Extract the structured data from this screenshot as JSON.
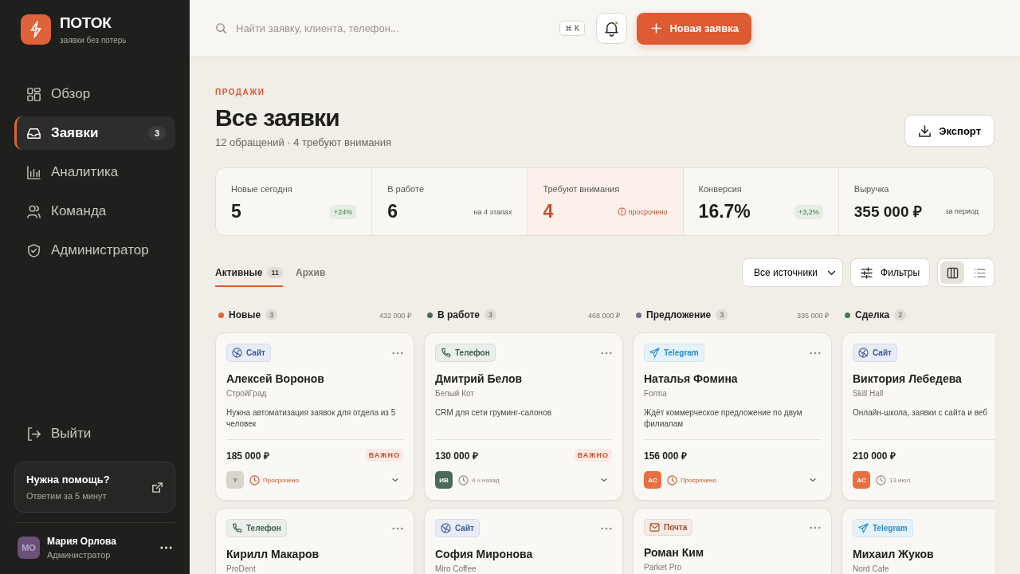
{
  "sidebar": {
    "brand": {
      "name": "ПОТОК",
      "tagline": "заявки без потерь"
    },
    "nav": [
      {
        "label": "Обзор",
        "kind": "grid",
        "selected": false
      },
      {
        "label": "Заявки",
        "kind": "inbox",
        "selected": true,
        "badge": "3"
      },
      {
        "label": "Аналитика",
        "kind": "chart",
        "selected": false
      },
      {
        "label": "Команда",
        "kind": "users",
        "selected": false
      },
      {
        "label": "Администратор",
        "kind": "shield",
        "selected": false
      }
    ],
    "logout": "Выйти",
    "help": {
      "title": "Нужна помощь?",
      "subtitle": "Ответим за 5 минут"
    },
    "user": {
      "initials": "МО",
      "name": "Мария Орлова",
      "role": "Администратор"
    }
  },
  "topbar": {
    "search": {
      "placeholder": "Найти заявку, клиента, телефон..."
    },
    "shortcut": [
      "⌘",
      "K"
    ],
    "notifications": {
      "unread": true
    },
    "new_button": "Новая заявка"
  },
  "header": {
    "eyebrow": "ПРОДАЖИ",
    "title": "Все заявки",
    "subtitle": "12 обращений · 4 требуют внимания",
    "export_button": "Экспорт"
  },
  "stats": [
    {
      "label": "Новые сегодня",
      "value": "5",
      "note": "+24%",
      "kind": "badge",
      "alert": false
    },
    {
      "label": "В работе",
      "value": "6",
      "note": "на 4 этапах",
      "kind": "text",
      "alert": false
    },
    {
      "label": "Требуют внимания",
      "value": "4",
      "note": "просрочено",
      "kind": "warning",
      "alert": true
    },
    {
      "label": "Конверсия",
      "value": "16.7%",
      "note": "+3,2%",
      "kind": "badge",
      "alert": false
    },
    {
      "label": "Выручка",
      "value": "355 000 ₽",
      "note": "за период",
      "kind": "text",
      "alert": false
    }
  ],
  "tabs": [
    {
      "label": "Активные",
      "count": "11",
      "selected": true
    },
    {
      "label": "Архив",
      "selected": false
    }
  ],
  "toolbar": {
    "source_filter": "Все источники",
    "filters_button": "Фильтры",
    "views": [
      {
        "kind": "board",
        "selected": true
      },
      {
        "kind": "list",
        "selected": false
      }
    ]
  },
  "columns": [
    {
      "title": "Новые",
      "color": "#e0623a",
      "count": "3",
      "total": "432 000 ₽",
      "cards": [
        {
          "source": {
            "kind": "site",
            "label": "Сайт"
          },
          "name": "Алексей Воронов",
          "company": "СтройГрад",
          "description": "Нужна автоматизация заявок для отдела из 5 человек",
          "amount": "185 000 ₽",
          "important": true,
          "important_label": "ВАЖНО",
          "assignee": {
            "initials": "?",
            "color": "#d9d5cc"
          },
          "time": {
            "label": "Просрочено",
            "overdue": true
          }
        },
        {
          "source": {
            "kind": "phone",
            "label": "Телефон"
          },
          "name": "Кирилл Макаров",
          "company": "ProDent"
        }
      ]
    },
    {
      "title": "В работе",
      "color": "#4a6b5a",
      "count": "3",
      "total": "468 000 ₽",
      "cards": [
        {
          "source": {
            "kind": "phone",
            "label": "Телефон"
          },
          "name": "Дмитрий Белов",
          "company": "Белый Кот",
          "description": "CRM для сети груминг-салонов",
          "amount": "130 000 ₽",
          "important": true,
          "important_label": "ВАЖНО",
          "assignee": {
            "initials": "ИВ",
            "color": "#4a6b5a"
          },
          "time": {
            "label": "4 ч назад",
            "overdue": false
          }
        },
        {
          "source": {
            "kind": "site",
            "label": "Сайт"
          },
          "name": "София Миронова",
          "company": "Miro Coffee"
        }
      ]
    },
    {
      "title": "Предложение",
      "color": "#777090",
      "count": "3",
      "total": "335 000 ₽",
      "cards": [
        {
          "source": {
            "kind": "telegram",
            "label": "Telegram"
          },
          "name": "Наталья Фомина",
          "company": "Forma",
          "description": "Ждёт коммерческое предложение по двум филиалам",
          "amount": "156 000 ₽",
          "important": false,
          "assignee": {
            "initials": "АС",
            "color": "#e8703f"
          },
          "time": {
            "label": "Просрочено",
            "overdue": true
          }
        },
        {
          "source": {
            "kind": "mail",
            "label": "Почта"
          },
          "name": "Роман Ким",
          "company": "Parket Pro"
        }
      ]
    },
    {
      "title": "Сделка",
      "color": "#3d7a4a",
      "count": "2",
      "cards": [
        {
          "source": {
            "kind": "site",
            "label": "Сайт"
          },
          "name": "Виктория Лебедева",
          "company": "Skill Hall",
          "description": "Онлайн-школа, заявки с сайта и веб",
          "amount": "210 000 ₽",
          "important": false,
          "assignee": {
            "initials": "АС",
            "color": "#e8703f"
          },
          "time": {
            "label": "13 июл.",
            "overdue": false
          }
        },
        {
          "source": {
            "kind": "telegram",
            "label": "Telegram"
          },
          "name": "Михаил Жуков",
          "company": "Nord Cafe"
        }
      ]
    }
  ]
}
